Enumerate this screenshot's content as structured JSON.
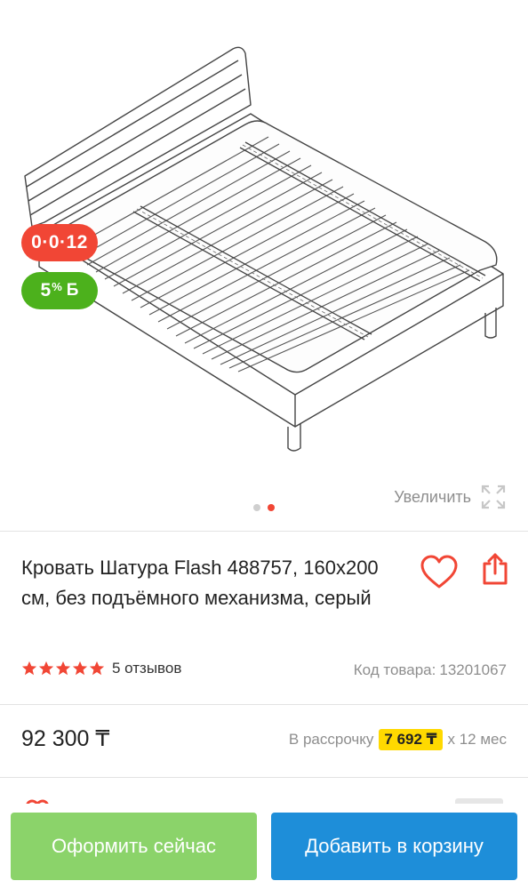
{
  "badges": {
    "installment": "0·0·12",
    "bonus_value": "5",
    "bonus_unit": "%",
    "bonus_currency": "Б"
  },
  "gallery": {
    "zoom_label": "Увеличить",
    "zoom_icon": "expand-icon",
    "dots_total": 2,
    "active_dot": 2
  },
  "product": {
    "title": "Кровать Шатура Flash 488757, 160х200 см, без подъёмного механизма, серый",
    "reviews_label": "5 отзывов",
    "rating_stars": 5,
    "sku_label": "Код товара:",
    "sku_value": "13201067",
    "price": "92 300 ₸",
    "installment_prefix": "В рассрочку",
    "installment_amount": "7 692 ₸",
    "installment_suffix": "х 12 мес"
  },
  "actions": {
    "buy_now": "Оформить сейчас",
    "add_to_cart": "Добавить в корзину"
  },
  "colors": {
    "red": "#f14635",
    "green": "#4cb11c",
    "buy_button": "#8bd36a",
    "cart_button": "#1e8ed9",
    "highlight": "#ffd900"
  }
}
